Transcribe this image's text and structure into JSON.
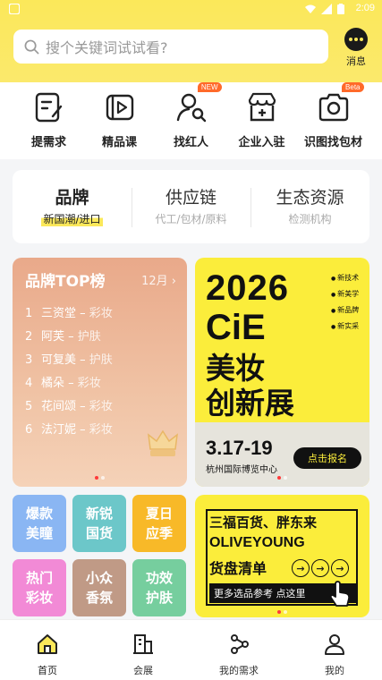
{
  "status": {
    "time": "2:09"
  },
  "search": {
    "placeholder": "搜个关键词试试看?"
  },
  "messages": {
    "label": "消息"
  },
  "categories": [
    {
      "label": "提需求",
      "icon": "edit-doc-icon"
    },
    {
      "label": "精品课",
      "icon": "video-play-icon"
    },
    {
      "label": "找红人",
      "icon": "person-search-icon",
      "badge": "NEW"
    },
    {
      "label": "企业入驻",
      "icon": "store-plus-icon"
    },
    {
      "label": "识图找包材",
      "icon": "camera-icon",
      "badge": "Beta"
    }
  ],
  "tabs": [
    {
      "title": "品牌",
      "subtitle": "新国潮/进口"
    },
    {
      "title": "供应链",
      "subtitle": "代工/包材/原料"
    },
    {
      "title": "生态资源",
      "subtitle": "检测机构"
    }
  ],
  "brand_top": {
    "title": "品牌TOP榜",
    "month": "12月",
    "items": [
      {
        "rank": "1",
        "name": "三资堂",
        "category": "彩妆"
      },
      {
        "rank": "2",
        "name": "阿芙",
        "category": "护肤"
      },
      {
        "rank": "3",
        "name": "可复美",
        "category": "护肤"
      },
      {
        "rank": "4",
        "name": "橘朵",
        "category": "彩妆"
      },
      {
        "rank": "5",
        "name": "花间颂",
        "category": "彩妆"
      },
      {
        "rank": "6",
        "name": "法汀妮",
        "category": "彩妆"
      }
    ]
  },
  "cie": {
    "year": "2026",
    "name": "CiE",
    "line1": "美妆",
    "line2": "创新展",
    "tags": [
      "新技术",
      "新美学",
      "新品牌",
      "新实采"
    ],
    "date": "3.17-19",
    "place": "杭州国际博览中心",
    "cta": "点击报名"
  },
  "grid": [
    {
      "label": "爆款\n美瞳",
      "color": "#8ab6f3"
    },
    {
      "label": "新锐\n国货",
      "color": "#6cc7c9"
    },
    {
      "label": "夏日\n应季",
      "color": "#f8b928"
    },
    {
      "label": "热门\n彩妆",
      "color": "#f28ad6"
    },
    {
      "label": "小众\n香氛",
      "color": "#c09a86"
    },
    {
      "label": "功效\n护肤",
      "color": "#76ce9e"
    }
  ],
  "banner": {
    "line1": "三福百货、胖东来",
    "line2": "OLIVEYOUNG",
    "line3": "货盘清单",
    "bar": "更多选品参考  点这里"
  },
  "nav": [
    {
      "label": "首页",
      "icon": "home-icon"
    },
    {
      "label": "会展",
      "icon": "building-icon"
    },
    {
      "label": "我的需求",
      "icon": "network-icon"
    },
    {
      "label": "我的",
      "icon": "user-icon"
    }
  ]
}
